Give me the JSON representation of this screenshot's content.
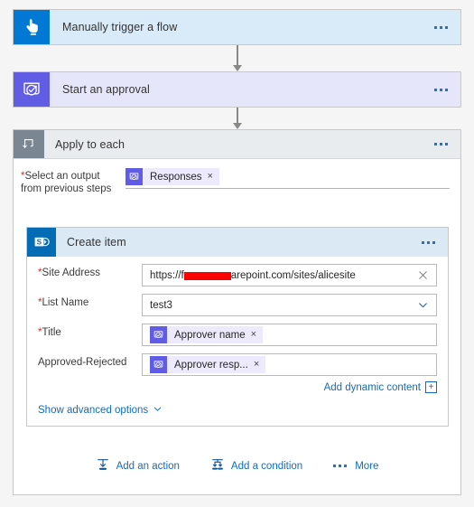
{
  "flow": {
    "trigger": {
      "title": "Manually trigger a flow",
      "icon": "hand-tap-icon",
      "accent": "#0078d4",
      "background": "#d9eaf9",
      "overflow_label": "..."
    },
    "approval": {
      "title": "Start an approval",
      "icon": "approval-check-icon",
      "accent": "#605ce4",
      "background": "#e6e6fa",
      "overflow_label": "..."
    },
    "scope": {
      "title": "Apply to each",
      "icon": "loop-icon",
      "accent": "#7a8793",
      "background": "#e8ecee",
      "overflow_label": "...",
      "select_output": {
        "label_line1": "Select an output",
        "label_line2": "from previous steps",
        "required": true,
        "required_marker": "*",
        "token": {
          "text": "Responses",
          "icon": "approval-check-icon",
          "remove_label": "×"
        }
      },
      "create_item": {
        "title": "Create item",
        "icon": "sharepoint-icon",
        "accent": "#036cb4",
        "background": "#dbe9f5",
        "overflow_label": "...",
        "fields": [
          {
            "label": "Site Address",
            "required": true,
            "required_marker": "*",
            "type": "text-redacted",
            "value_prefix": "https://f",
            "value_suffix": "arepoint.com/sites/alicesite",
            "redaction_color": "#ff0000",
            "trailing_icon": "clear-x-icon"
          },
          {
            "label": "List Name",
            "required": true,
            "required_marker": "*",
            "type": "dropdown",
            "value": "test3",
            "trailing_icon": "chevron-down-icon"
          },
          {
            "label": "Title",
            "required": true,
            "required_marker": "*",
            "type": "token",
            "token": {
              "text": "Approver name",
              "icon": "approval-check-icon",
              "remove_label": "×"
            }
          },
          {
            "label": "Approved-Rejected",
            "required": false,
            "required_marker": "",
            "type": "token",
            "token": {
              "text": "Approver resp...",
              "icon": "approval-check-icon",
              "remove_label": "×"
            }
          }
        ],
        "add_dynamic_content": {
          "label": "Add dynamic content",
          "plus_label": "+"
        },
        "show_advanced_options": {
          "label": "Show advanced options",
          "icon": "chevron-down-icon"
        }
      },
      "actions": [
        {
          "label": "Add an action",
          "icon": "add-action-icon"
        },
        {
          "label": "Add a condition",
          "icon": "add-condition-icon"
        },
        {
          "label": "More",
          "icon": "ellipsis-icon"
        }
      ]
    }
  }
}
